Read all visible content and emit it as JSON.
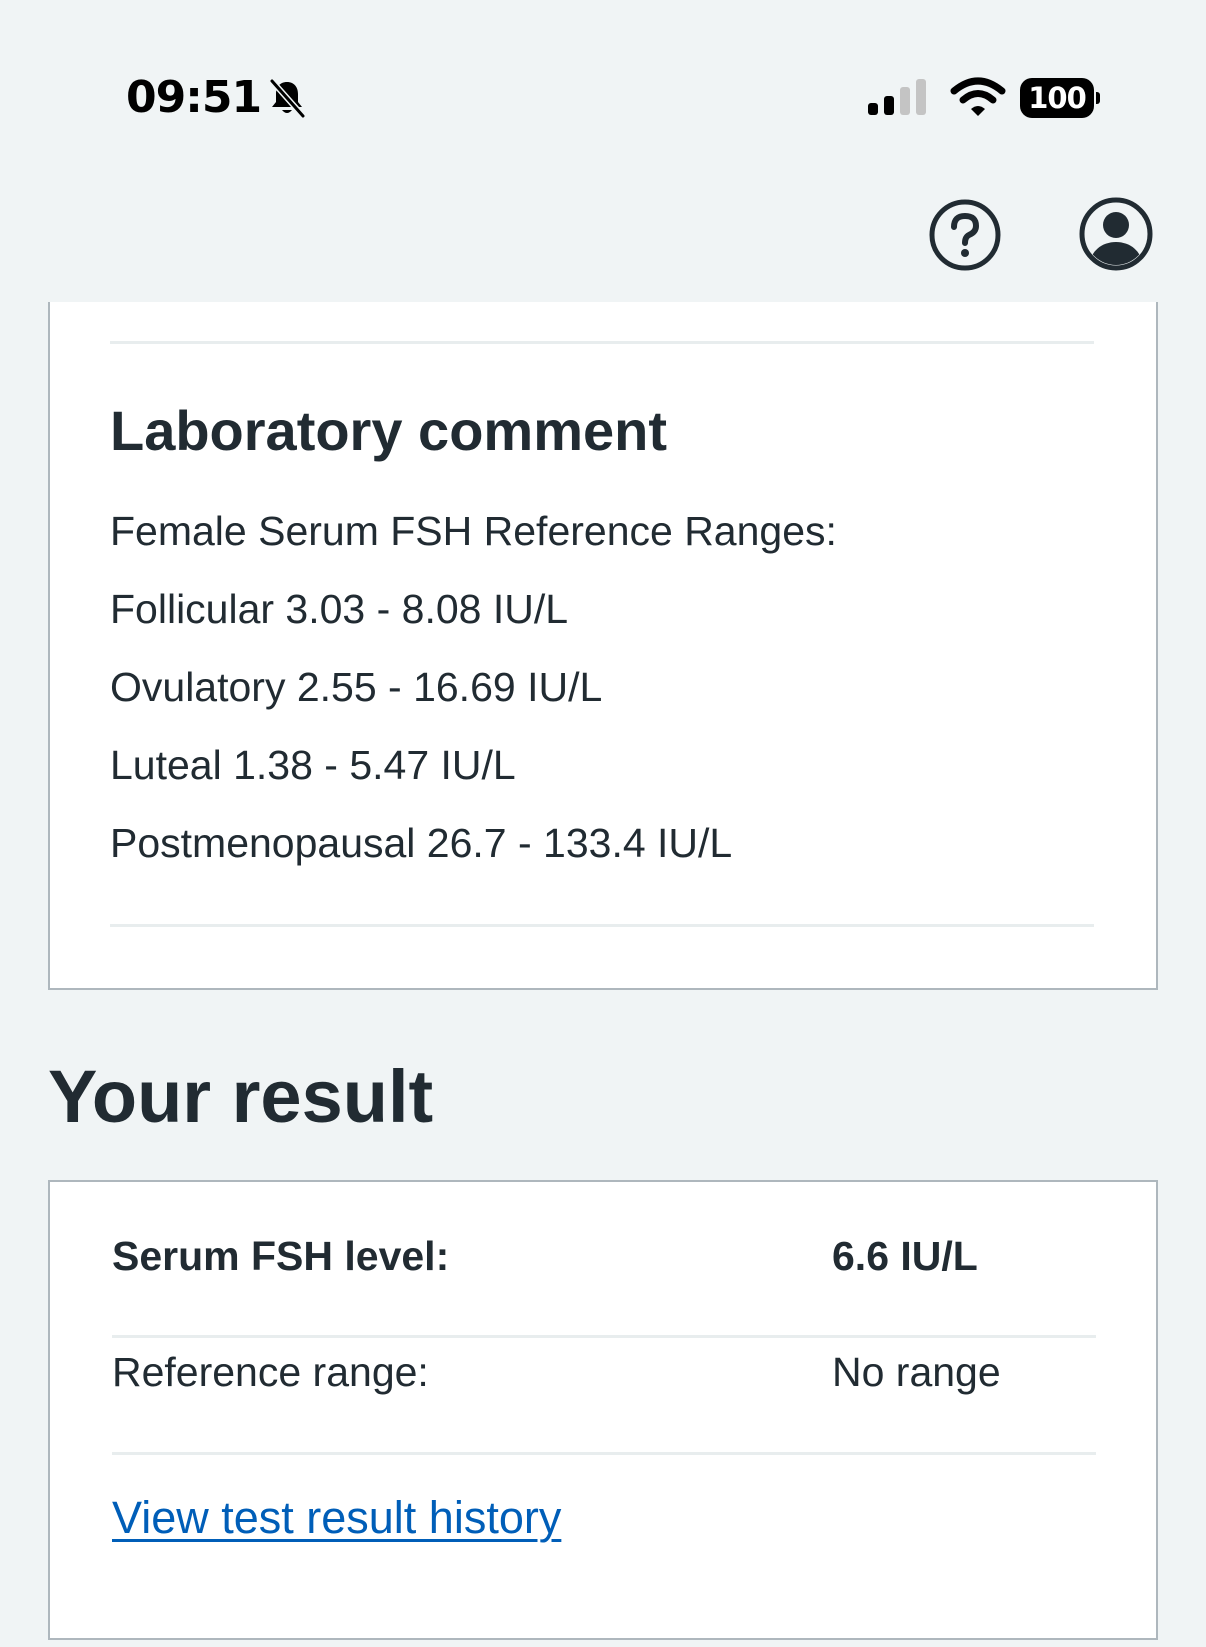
{
  "status_bar": {
    "time": "09:51",
    "battery": "100",
    "icons": [
      "bell-slash-icon",
      "cellular-signal-icon",
      "wifi-icon",
      "battery-icon"
    ]
  },
  "header": {
    "icons": [
      "help-icon",
      "account-icon"
    ]
  },
  "lab_comment": {
    "title": "Laboratory comment",
    "lines": [
      "Female Serum FSH Reference Ranges:",
      "Follicular 3.03 - 8.08 IU/L",
      "Ovulatory 2.55 - 16.69 IU/L",
      "Luteal 1.38 - 5.47 IU/L",
      "Postmenopausal 26.7 - 133.4 IU/L"
    ]
  },
  "result": {
    "heading": "Your result",
    "rows": [
      {
        "label": "Serum FSH level:",
        "value": "6.6 IU/L"
      },
      {
        "label": "Reference range:",
        "value": "No range"
      }
    ],
    "history_link": "View test result history"
  },
  "colors": {
    "background": "#f0f4f5",
    "card": "#ffffff",
    "card_border": "#aeb7bd",
    "text": "#212b32",
    "link": "#005eb8",
    "divider": "#e8edee"
  }
}
